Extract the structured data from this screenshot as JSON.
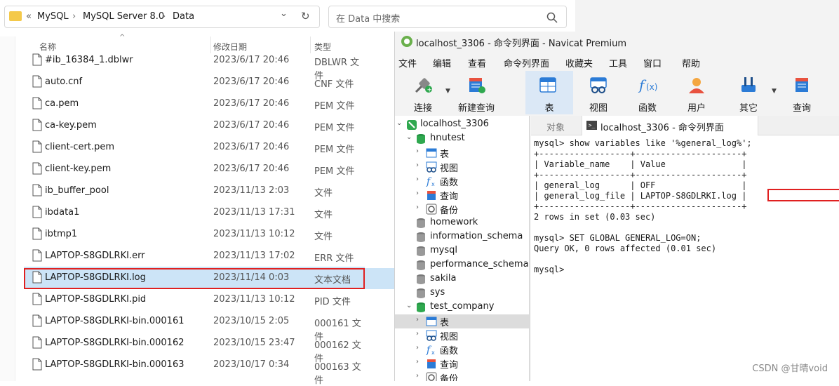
{
  "explorer": {
    "nav_chevron": "«",
    "breadcrumb": [
      "MySQL",
      "MySQL Server 8.0",
      "Data"
    ],
    "breadcrumb_sep": "›",
    "dropdown_glyph": "⌄",
    "refresh_glyph": "↻",
    "search_placeholder": "在 Data 中搜索",
    "columns": {
      "name": "名称",
      "date": "修改日期",
      "type": "类型"
    },
    "files": [
      {
        "name": "#ib_16384_1.dblwr",
        "date": "2023/6/17 20:46",
        "type": "DBLWR 文件"
      },
      {
        "name": "auto.cnf",
        "date": "2023/6/17 20:46",
        "type": "CNF 文件"
      },
      {
        "name": "ca.pem",
        "date": "2023/6/17 20:46",
        "type": "PEM 文件"
      },
      {
        "name": "ca-key.pem",
        "date": "2023/6/17 20:46",
        "type": "PEM 文件"
      },
      {
        "name": "client-cert.pem",
        "date": "2023/6/17 20:46",
        "type": "PEM 文件"
      },
      {
        "name": "client-key.pem",
        "date": "2023/6/17 20:46",
        "type": "PEM 文件"
      },
      {
        "name": "ib_buffer_pool",
        "date": "2023/11/13 2:03",
        "type": "文件"
      },
      {
        "name": "ibdata1",
        "date": "2023/11/13 17:31",
        "type": "文件"
      },
      {
        "name": "ibtmp1",
        "date": "2023/11/13 10:12",
        "type": "文件"
      },
      {
        "name": "LAPTOP-S8GDLRKI.err",
        "date": "2023/11/13 17:02",
        "type": "ERR 文件"
      },
      {
        "name": "LAPTOP-S8GDLRKI.log",
        "date": "2023/11/14 0:03",
        "type": "文本文档"
      },
      {
        "name": "LAPTOP-S8GDLRKI.pid",
        "date": "2023/11/13 10:12",
        "type": "PID 文件"
      },
      {
        "name": "LAPTOP-S8GDLRKI-bin.000161",
        "date": "2023/10/15 2:05",
        "type": "000161 文件"
      },
      {
        "name": "LAPTOP-S8GDLRKI-bin.000162",
        "date": "2023/10/15 23:47",
        "type": "000162 文件"
      },
      {
        "name": "LAPTOP-S8GDLRKI-bin.000163",
        "date": "2023/10/17 0:34",
        "type": "000163 文件"
      }
    ]
  },
  "navicat": {
    "title": "localhost_3306 - 命令列界面 - Navicat Premium",
    "menu": [
      "文件",
      "编辑",
      "查看",
      "命令列界面",
      "收藏夹",
      "工具",
      "窗口",
      "帮助"
    ],
    "toolbar": [
      "连接",
      "新建查询",
      "表",
      "视图",
      "函数",
      "用户",
      "其它",
      "查询"
    ],
    "tree": [
      {
        "label": "localhost_3306",
        "kind": "server",
        "level": 0,
        "arrow": "⌄"
      },
      {
        "label": "hnutest",
        "kind": "db-green",
        "level": 1,
        "arrow": "⌄"
      },
      {
        "label": "表",
        "kind": "table",
        "level": 2,
        "arrow": "›"
      },
      {
        "label": "视图",
        "kind": "view",
        "level": 2,
        "arrow": "›"
      },
      {
        "label": "函数",
        "kind": "func",
        "level": 2,
        "arrow": "›"
      },
      {
        "label": "查询",
        "kind": "query",
        "level": 2,
        "arrow": "›"
      },
      {
        "label": "备份",
        "kind": "backup",
        "level": 2,
        "arrow": "›"
      },
      {
        "label": "homework",
        "kind": "db-gray",
        "level": 1,
        "arrow": ""
      },
      {
        "label": "information_schema",
        "kind": "db-gray",
        "level": 1,
        "arrow": ""
      },
      {
        "label": "mysql",
        "kind": "db-gray",
        "level": 1,
        "arrow": ""
      },
      {
        "label": "performance_schema",
        "kind": "db-gray",
        "level": 1,
        "arrow": ""
      },
      {
        "label": "sakila",
        "kind": "db-gray",
        "level": 1,
        "arrow": ""
      },
      {
        "label": "sys",
        "kind": "db-gray",
        "level": 1,
        "arrow": ""
      },
      {
        "label": "test_company",
        "kind": "db-green",
        "level": 1,
        "arrow": "⌄"
      },
      {
        "label": "表",
        "kind": "table",
        "level": 2,
        "arrow": "›",
        "selected": true
      },
      {
        "label": "视图",
        "kind": "view",
        "level": 2,
        "arrow": "›"
      },
      {
        "label": "函数",
        "kind": "func",
        "level": 2,
        "arrow": "›"
      },
      {
        "label": "查询",
        "kind": "query",
        "level": 2,
        "arrow": "›"
      },
      {
        "label": "备份",
        "kind": "backup",
        "level": 2,
        "arrow": "›"
      }
    ],
    "tabs": {
      "objects": "对象",
      "console": "localhost_3306 - 命令列界面"
    },
    "console_lines": [
      "mysql> show variables like '%general_log%';",
      "+------------------+---------------------+",
      "| Variable_name    | Value               |",
      "+------------------+---------------------+",
      "| general_log      | OFF                 |",
      "| general_log_file | LAPTOP-S8GDLRKI.log |",
      "+------------------+---------------------+",
      "2 rows in set (0.03 sec)",
      "",
      "mysql> SET GLOBAL GENERAL_LOG=ON;",
      "Query OK, 0 rows affected (0.01 sec)",
      "",
      "mysql>"
    ]
  },
  "watermark": "CSDN @甘晴void",
  "colors": {
    "highlight": "#e02020",
    "selection": "#cce4f7",
    "tree_selection": "#dcdcdc",
    "toolbar_active": "#dbe8f6"
  }
}
